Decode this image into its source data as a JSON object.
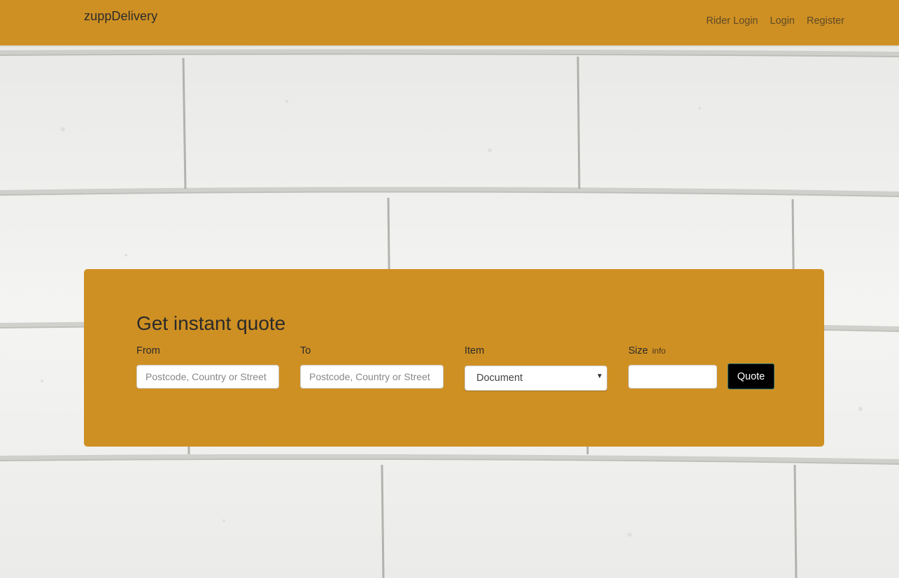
{
  "navbar": {
    "brand": "zuppDelivery",
    "links": [
      "Rider Login",
      "Login",
      "Register"
    ]
  },
  "quote_form": {
    "title": "Get instant quote",
    "from": {
      "label": "From",
      "placeholder": "Postcode, Country or Street",
      "value": ""
    },
    "to": {
      "label": "To",
      "placeholder": "Postcode, Country or Street",
      "value": ""
    },
    "item": {
      "label": "Item",
      "selected": "Document"
    },
    "size": {
      "label": "Size",
      "info": "info",
      "value": ""
    },
    "submit_label": "Quote"
  },
  "colors": {
    "accent": "#cf9023",
    "button": "#000000",
    "wall": "#f1f1ef"
  },
  "icons": {
    "select_caret": "caret-down-icon"
  }
}
